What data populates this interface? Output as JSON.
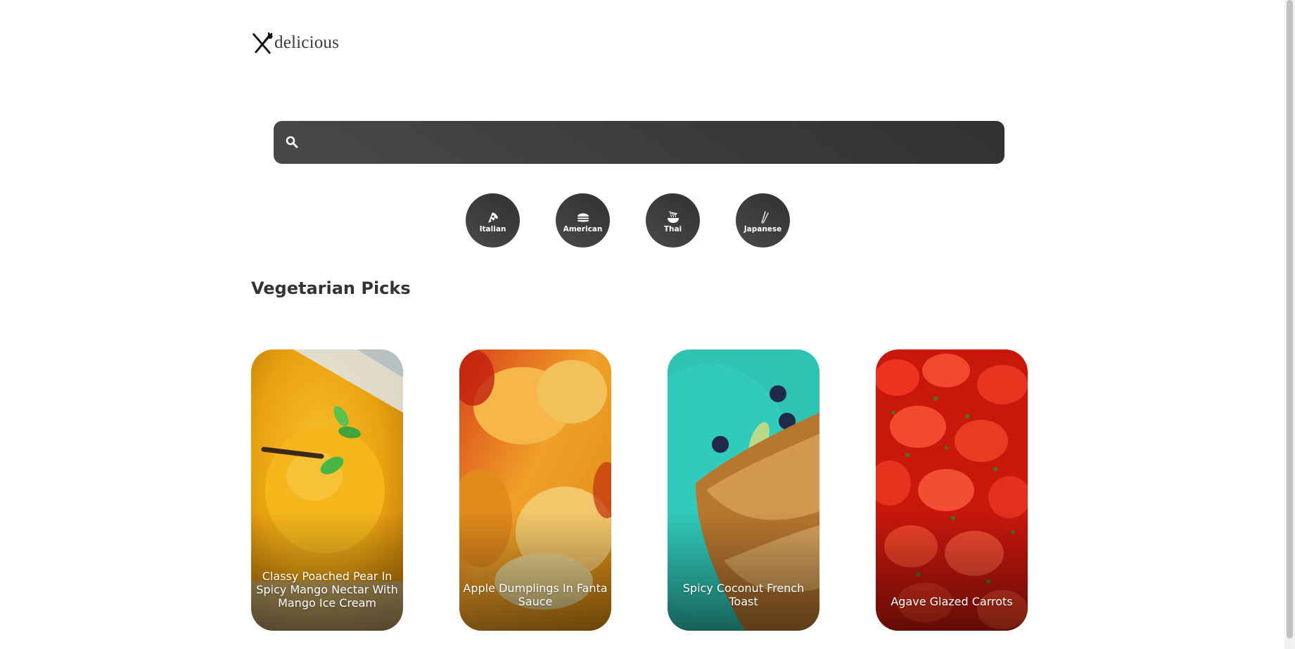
{
  "brand": {
    "name": "delicious",
    "icon": "fork-knife-crossed-icon"
  },
  "search": {
    "value": "",
    "placeholder": "",
    "icon": "search-icon"
  },
  "categories": [
    {
      "label": "Italian",
      "icon": "pizza-icon"
    },
    {
      "label": "American",
      "icon": "hamburger-icon"
    },
    {
      "label": "Thai",
      "icon": "noodle-bowl-icon"
    },
    {
      "label": "Japanese",
      "icon": "chopsticks-icon"
    }
  ],
  "section": {
    "title": "Vegetarian Picks"
  },
  "recipes": [
    {
      "title": "Classy Poached Pear In Spicy Mango Nectar With Mango Ice Cream",
      "image_colors": [
        "#f4b31a",
        "#e8a20e"
      ]
    },
    {
      "title": "Apple Dumplings In Fanta Sauce",
      "image_colors": [
        "#e69a1d",
        "#c83a10"
      ]
    },
    {
      "title": "Spicy Coconut French Toast",
      "image_colors": [
        "#2ec4b6",
        "#c98a4a"
      ]
    },
    {
      "title": "Agave Glazed Carrots",
      "image_colors": [
        "#e82b17",
        "#b0180c"
      ]
    }
  ],
  "colors": {
    "dark_gradient_start": "#494949",
    "dark_gradient_end": "#313131",
    "title_text": "#333333"
  }
}
